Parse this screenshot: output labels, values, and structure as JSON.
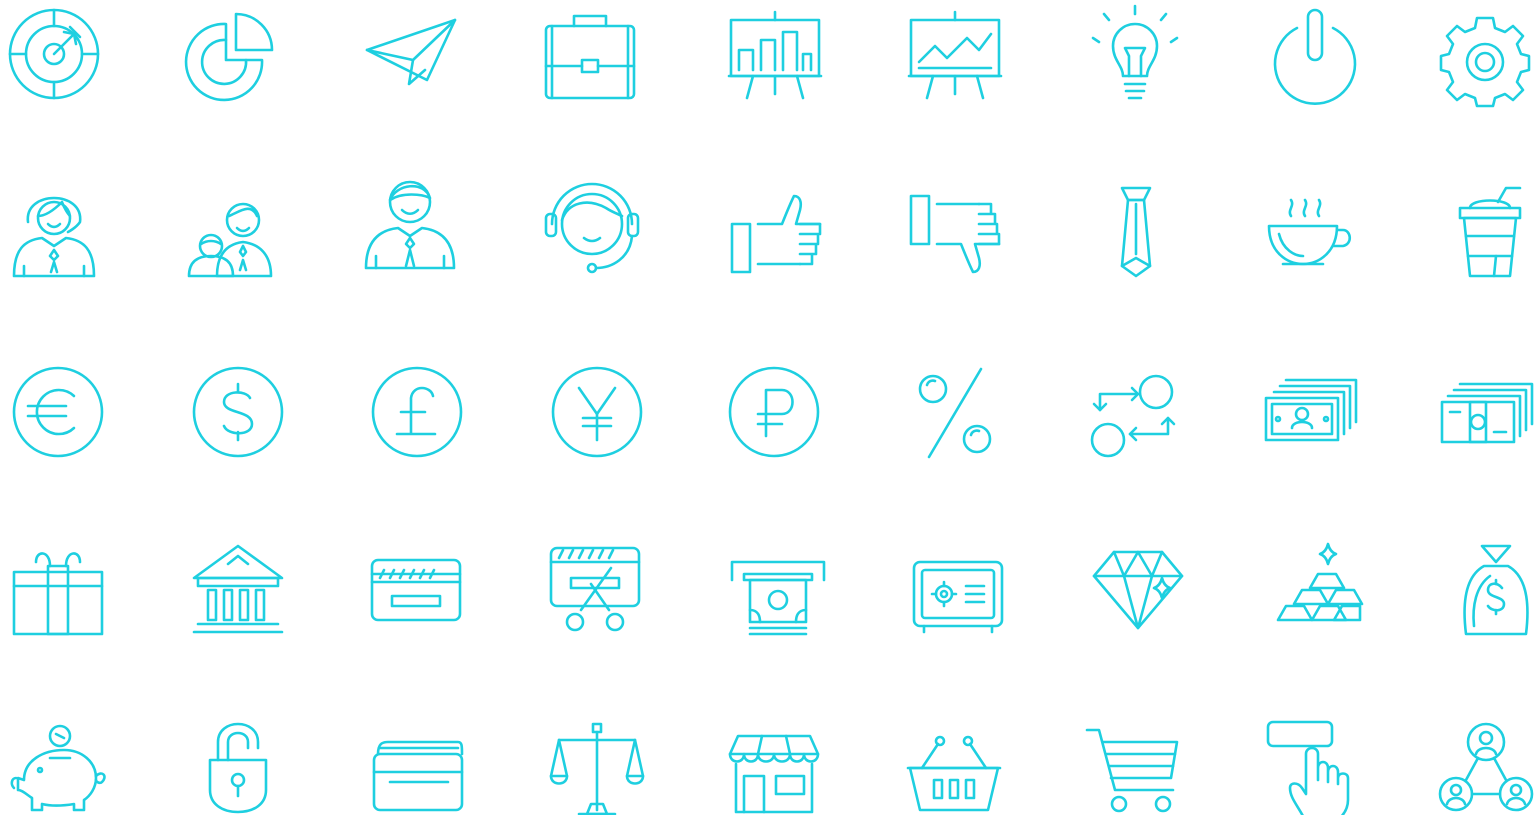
{
  "colors": {
    "icon_stroke": "#1ecfe0",
    "background": "#ffffff"
  },
  "icon_set": {
    "rows": [
      [
        "target-icon",
        "pie-chart-icon",
        "paper-plane-icon",
        "briefcase-icon",
        "presentation-bar-chart-icon",
        "presentation-line-chart-icon",
        "lightbulb-icon",
        "power-icon",
        "gear-icon"
      ],
      [
        "businesswoman-icon",
        "parent-child-icon",
        "businessman-icon",
        "headset-support-icon",
        "thumbs-up-icon",
        "thumbs-down-icon",
        "necktie-icon",
        "coffee-cup-icon",
        "takeaway-cup-icon"
      ],
      [
        "euro-coin-icon",
        "dollar-coin-icon",
        "pound-coin-icon",
        "yen-coin-icon",
        "ruble-coin-icon",
        "percent-icon",
        "currency-exchange-icon",
        "banknote-stack-icon",
        "money-bundle-icon"
      ],
      [
        "gift-box-icon",
        "bank-icon",
        "credit-card-icon",
        "cut-credit-card-icon",
        "atm-cash-icon",
        "safe-icon",
        "diamond-icon",
        "gold-bars-icon",
        "money-bag-icon"
      ],
      [
        "piggy-bank-icon",
        "padlock-icon",
        "wallet-icon",
        "scales-icon",
        "shop-icon",
        "shopping-basket-icon",
        "shopping-cart-icon",
        "touch-button-icon",
        "user-network-icon"
      ]
    ]
  }
}
